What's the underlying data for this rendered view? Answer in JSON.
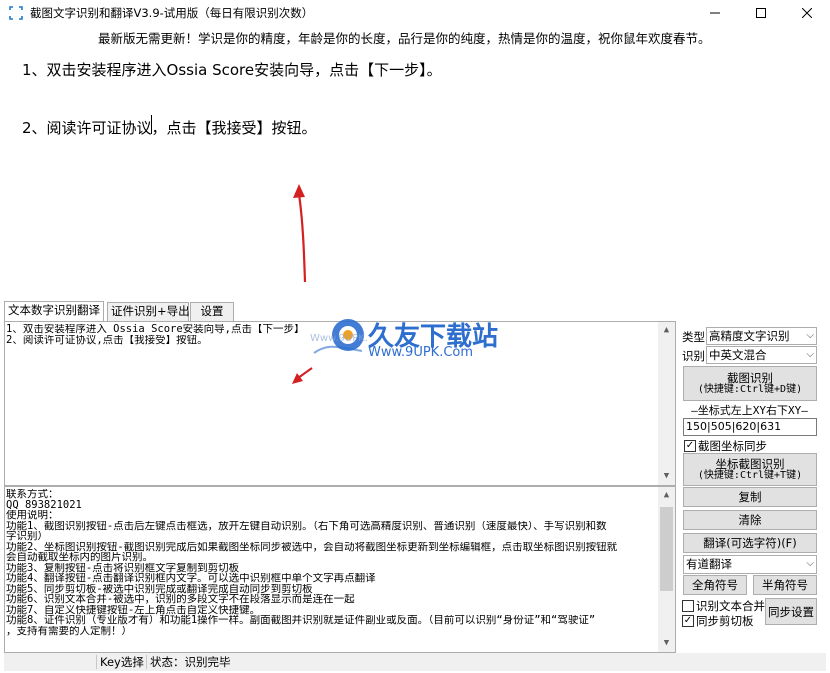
{
  "window": {
    "title": "截图文字识别和翻译V3.9-试用版（每日有限识别次数）"
  },
  "image_area": {
    "announcement": "最新版无需更新！学识是你的精度，年龄是你的长度，品行是你的纯度，热情是你的温度，祝你鼠年欢度春节。",
    "step1": "1、双击安装程序进入Ossia Score安装向导，点击【下一步】。",
    "step2": "2、阅读许可证协议，点击【我接受】按钮。"
  },
  "tabs": [
    {
      "label": "文本数字识别翻译"
    },
    {
      "label": "证件识别+导出"
    },
    {
      "label": "设置"
    }
  ],
  "result_text": [
    "1、双击安装程序进入 Ossia Score安装向导,点击【下一步】",
    "2、阅读许可证协议,点击【我接受】按钮。"
  ],
  "watermark": {
    "title": "久友下载站",
    "url": "Www.9UPK.Com",
    "faint": "Www.9UPK.Com"
  },
  "info_text": [
    "联系方式：",
    "QQ 893821021",
    "使用说明：",
    "功能1、截图识别按钮-点击后左键点击框选，放开左键自动识别。（右下角可选高精度识别、普通识别（速度最快）、手写识别和数",
    "字识别）",
    "功能2、坐标图识别按钮-截图识别完成后如果截图坐标同步被选中，会自动将截图坐标更新到坐标编辑框，点击取坐标图识别按钮就",
    "会自动截取坐标内的图片识别。",
    "功能3、复制按钮-点击将识别框文字复制到剪切板",
    "功能4、翻译按钮-点击翻译识别框内文字。可以选中识别框中单个文字再点翻译",
    "功能5、同步剪切板-被选中识别完成或翻译完成自动同步到剪切板",
    "功能6、识别文本合并-被选中，识别的多段文字不在段落显示而是连在一起",
    "功能7、自定义快捷键按钮-左上角点击自定义快捷键。",
    "功能8、证件识别（专业版才有）和功能1操作一样。副面截图并识别就是证件副业或反面。（目前可以识别“身份证”和“驾驶证”",
    "，支持有需要的人定制！）"
  ],
  "right_panel": {
    "type_label": "类型",
    "type_value": "高精度文字识别",
    "recog_label": "识别",
    "recog_value": "中英文混合",
    "screenshot_btn": "截图识别",
    "screenshot_hotkey": "(快捷键:Ctrl键+D键)",
    "coord_title": "—坐标式左上XY右下XY—",
    "coord_value": "150|505|620|631",
    "coord_sync": "截图坐标同步",
    "coord_btn": "坐标截图识别",
    "coord_hotkey": "(快捷键:Ctrl键+T键)",
    "copy_btn": "复制",
    "clear_btn": "清除",
    "translate_btn": "翻译(可选字符)(F)",
    "translate_mode": "有道翻译",
    "fullwidth_btn": "全角符号",
    "halfwidth_btn": "半角符号",
    "merge_label": "识别文本合并",
    "sync_clip_label": "同步剪切板",
    "sync_settings_btn": "同步设置"
  },
  "statusbar": {
    "key_select": "Key选择",
    "status": "状态：识别完毕"
  }
}
